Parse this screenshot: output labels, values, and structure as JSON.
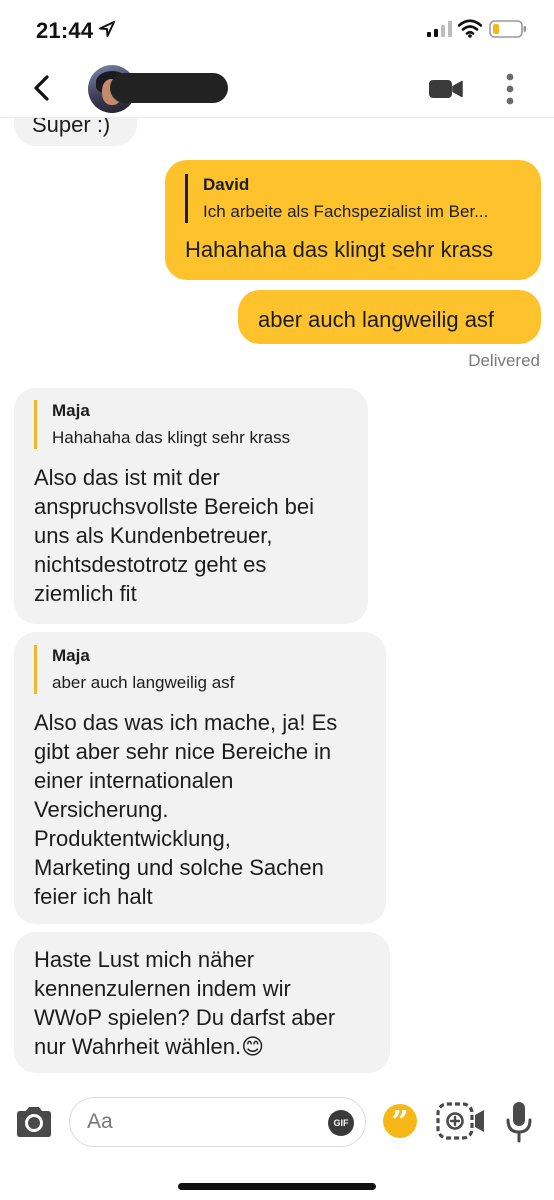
{
  "status_bar": {
    "time": "21:44",
    "icons": [
      "location-arrow-icon",
      "cellular-signal-icon",
      "wifi-icon",
      "battery-low-icon"
    ]
  },
  "header": {
    "back_icon": "chevron-left-icon",
    "avatar": "contact-avatar",
    "name_redacted": true,
    "actions": [
      "video-call-icon",
      "more-vertical-icon"
    ]
  },
  "messages": [
    {
      "direction": "in",
      "text": "Super :)"
    },
    {
      "direction": "out",
      "reply_to": {
        "author": "David",
        "text": "Ich arbeite als Fachspezialist im Ber..."
      },
      "text": "Hahahaha das klingt sehr krass"
    },
    {
      "direction": "out",
      "text": "aber auch langweilig asf"
    },
    {
      "direction": "in",
      "reply_to": {
        "author": "Maja",
        "text": "Hahahaha das klingt sehr krass"
      },
      "text": "Also das ist mit der\nanspruchsvollste Bereich bei\nuns als Kundenbetreuer,\nnichtsdestotrotz geht es\nziemlich fit"
    },
    {
      "direction": "in",
      "reply_to": {
        "author": "Maja",
        "text": "aber auch langweilig asf"
      },
      "text": "Also das was ich mache, ja! Es\ngibt aber sehr nice Bereiche in\neiner internationalen\nVersicherung.\nProduktentwicklung,\nMarketing und solche Sachen\nfeier ich halt"
    },
    {
      "direction": "in",
      "text": "Haste Lust mich näher\nkennenzulernen indem wir\nWWoP spielen? Du darfst aber\nnur Wahrheit wählen.😊"
    }
  ],
  "delivered_label": "Delivered",
  "composer": {
    "placeholder": "Aa",
    "gif_label": "GIF",
    "icons": [
      "camera-icon",
      "gif-icon",
      "quote-icon",
      "video-note-icon",
      "microphone-icon"
    ]
  },
  "colors": {
    "outgoing_bubble": "#fdc22c",
    "incoming_bubble": "#f2f2f2",
    "quote_button": "#f7b817"
  }
}
